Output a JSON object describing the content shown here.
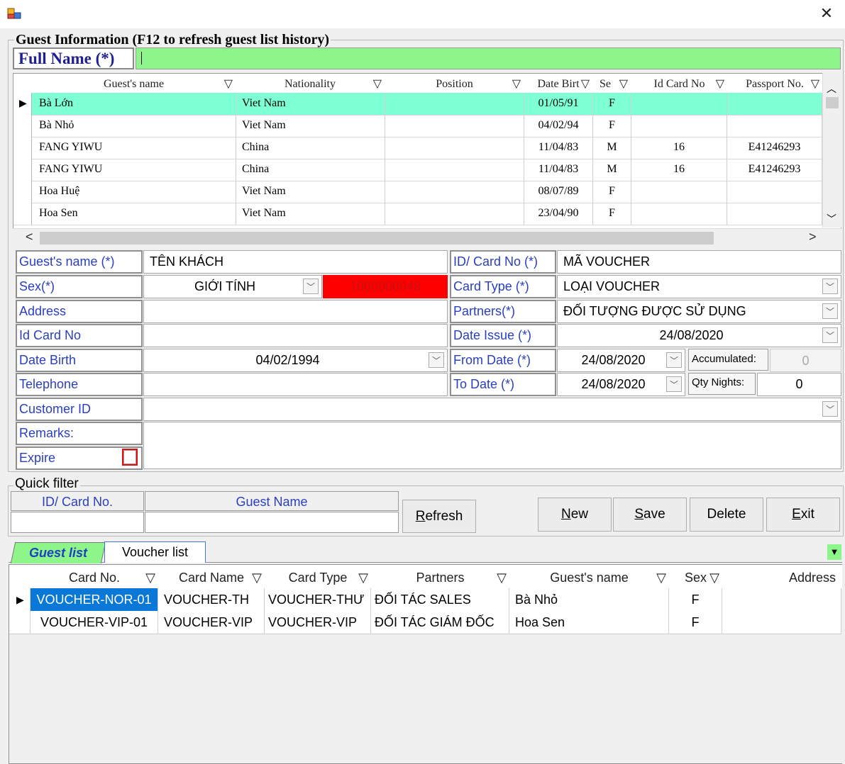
{
  "window": {
    "close_glyph": "✕"
  },
  "guest_info": {
    "group_title": "Guest Information (F12 to refresh guest list history)",
    "full_name_label": "Full Name (*)",
    "full_name_value": ""
  },
  "guest_history": {
    "columns": [
      "Guest's name",
      "Nationality",
      "Position",
      "Date Birt",
      "Se",
      "Id Card No",
      "Passport No."
    ],
    "rows": [
      {
        "name": "Bà Lớn",
        "nationality": "Viet Nam",
        "position": "",
        "dob": "01/05/91",
        "sex": "F",
        "id_card": "",
        "passport": ""
      },
      {
        "name": "Bà Nhỏ",
        "nationality": "Viet Nam",
        "position": "",
        "dob": "04/02/94",
        "sex": "F",
        "id_card": "",
        "passport": ""
      },
      {
        "name": "FANG YIWU",
        "nationality": "China",
        "position": "",
        "dob": "11/04/83",
        "sex": "M",
        "id_card": "16",
        "passport": "E41246293"
      },
      {
        "name": "FANG YIWU",
        "nationality": "China",
        "position": "",
        "dob": "11/04/83",
        "sex": "M",
        "id_card": "16",
        "passport": "E41246293"
      },
      {
        "name": "Hoa Huệ",
        "nationality": "Viet Nam",
        "position": "",
        "dob": "08/07/89",
        "sex": "F",
        "id_card": "",
        "passport": ""
      },
      {
        "name": "Hoa Sen",
        "nationality": "Viet Nam",
        "position": "",
        "dob": "23/04/90",
        "sex": "F",
        "id_card": "",
        "passport": ""
      }
    ],
    "selected_row": 0
  },
  "form": {
    "guest_name_label": "Guest's name (*)",
    "guest_name_value": "TÊN KHÁCH",
    "sex_label": "Sex(*)",
    "sex_value": "GIỚI TÍNH",
    "code_value": "1000000048",
    "address_label": "Address",
    "address_value": "",
    "id_card_label": "Id Card No",
    "id_card_value": "",
    "date_birth_label": "Date Birth",
    "date_birth_value": "04/02/1994",
    "telephone_label": "Telephone",
    "telephone_value": "",
    "customer_id_label": "Customer ID",
    "customer_id_value": "",
    "remarks_label": "Remarks:",
    "remarks_value": "",
    "expire_label": "Expire",
    "expire_checked": false,
    "card_no_label": "ID/ Card No (*)",
    "card_no_value": "MÃ VOUCHER",
    "card_type_label": "Card Type (*)",
    "card_type_value": "LOẠI VOUCHER",
    "partners_label": "Partners(*)",
    "partners_value": "ĐỐI TƯỢNG ĐƯỢC SỬ DỤNG",
    "date_issue_label": "Date Issue (*)",
    "date_issue_value": "24/08/2020",
    "from_date_label": "From Date (*)",
    "from_date_value": "24/08/2020",
    "to_date_label": "To Date (*)",
    "to_date_value": "24/08/2020",
    "accumulated_label": "Accumulated:",
    "accumulated_value": "0",
    "qty_nights_label": "Qty Nights:",
    "qty_nights_value": "0",
    "code_color": "#ff0000",
    "full_name_color": "#8ef58a",
    "selected_color": "#7fffd4"
  },
  "quick_filter": {
    "title": "Quick filter",
    "id_card_header": "ID/ Card No.",
    "guest_name_header": "Guest Name",
    "id_card_value": "",
    "guest_name_value": "",
    "refresh_label": "Refresh",
    "refresh_underline": "R"
  },
  "actions": {
    "new_label": "New",
    "save_label": "Save",
    "delete_label": "Delete",
    "exit_label": "Exit"
  },
  "tabs": {
    "guest_list": "Guest list",
    "voucher_list": "Voucher list",
    "active": "guest_list"
  },
  "voucher_grid": {
    "columns": [
      "Card No.",
      "Card Name",
      "Card Type",
      "Partners",
      "Guest's name",
      "Sex",
      "Address"
    ],
    "rows": [
      {
        "card_no": "VOUCHER-NOR-01",
        "card_name": "VOUCHER-TH",
        "card_type": "VOUCHER-THƯ",
        "partners": "ĐỐI TÁC SALES",
        "guest_name": "Bà Nhỏ",
        "sex": "F",
        "address": ""
      },
      {
        "card_no": "VOUCHER-VIP-01",
        "card_name": "VOUCHER-VIP",
        "card_type": "VOUCHER-VIP",
        "partners": "ĐỐI TÁC GIÁM ĐỐC",
        "guest_name": "Hoa Sen",
        "sex": "F",
        "address": ""
      }
    ],
    "selected_row": 0
  }
}
